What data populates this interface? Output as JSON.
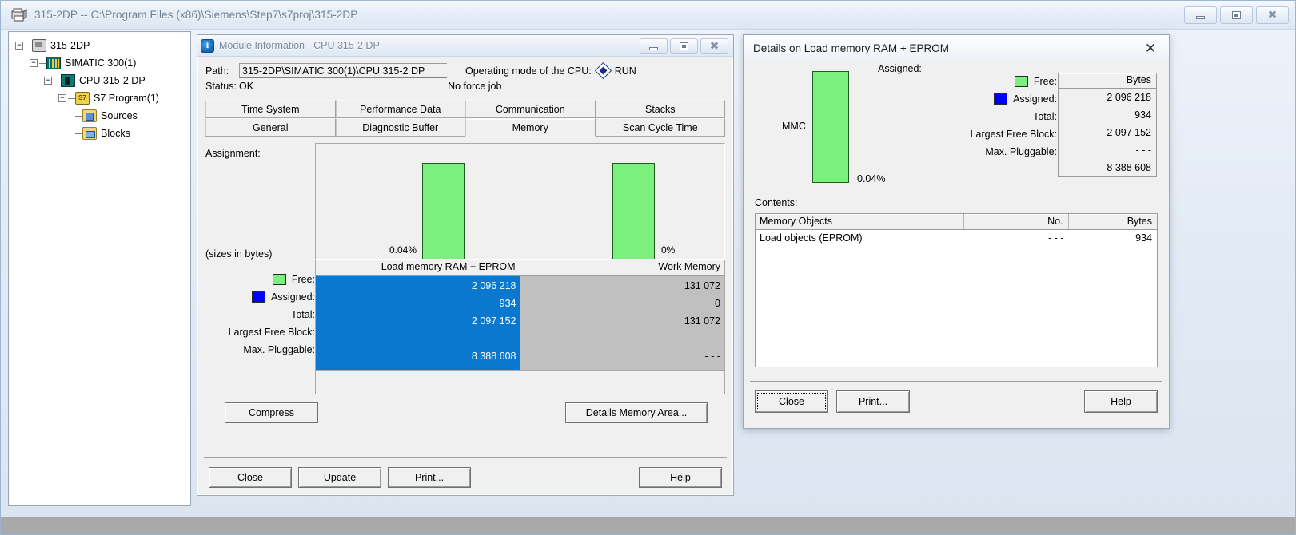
{
  "window": {
    "title": "315-2DP -- C:\\Program Files (x86)\\Siemens\\Step7\\s7proj\\315-2DP",
    "icon": "project-icon",
    "minimize": "–",
    "maximize": "□",
    "close": "✕"
  },
  "tree": {
    "items": [
      {
        "label": "315-2DP",
        "expander": "-",
        "icon": "project-icon",
        "indent": 0
      },
      {
        "label": "SIMATIC 300(1)",
        "expander": "-",
        "icon": "station-icon",
        "indent": 1
      },
      {
        "label": "CPU 315-2 DP",
        "expander": "-",
        "icon": "cpu-icon",
        "indent": 2
      },
      {
        "label": "S7 Program(1)",
        "expander": "-",
        "icon": "s7-program-icon",
        "indent": 3
      },
      {
        "label": "Sources",
        "expander": "",
        "icon": "sources-folder-icon",
        "indent": 4
      },
      {
        "label": "Blocks",
        "expander": "",
        "icon": "blocks-folder-icon",
        "indent": 4
      }
    ],
    "s7_icon_text": "S7"
  },
  "module_info": {
    "title": "Module Information - CPU 315-2 DP",
    "path_label": "Path:",
    "path_value": "315-2DP\\SIMATIC 300(1)\\CPU 315-2 DP",
    "status_label": "Status:",
    "status_value": "OK",
    "opmode_label": "Operating mode of the  CPU:",
    "opmode_value": "RUN",
    "force_job": "No force job",
    "tabs_top": [
      {
        "label": "Time System",
        "active": false
      },
      {
        "label": "Performance Data",
        "active": false
      },
      {
        "label": "Communication",
        "active": false
      },
      {
        "label": "Stacks",
        "active": false
      }
    ],
    "tabs_bottom": [
      {
        "label": "General",
        "active": false
      },
      {
        "label": "Diagnostic Buffer",
        "active": false
      },
      {
        "label": "Memory",
        "active": true
      },
      {
        "label": "Scan Cycle Time",
        "active": false
      }
    ],
    "assignment_label": "Assignment:",
    "sizes_label": "(sizes in bytes)",
    "legend": [
      {
        "label": "Free:",
        "color": "#7cf07c",
        "swatch": true
      },
      {
        "label": "Assigned:",
        "color": "#0000ff",
        "swatch": true
      },
      {
        "label": "Total:",
        "color": "",
        "swatch": false
      },
      {
        "label": "Largest Free Block:",
        "color": "",
        "swatch": false
      },
      {
        "label": "Max. Pluggable:",
        "color": "",
        "swatch": false
      }
    ],
    "columns": [
      {
        "header": "Load memory RAM + EPROM",
        "selected": true,
        "values": [
          "2 096 218",
          "934",
          "2 097 152",
          "- - -",
          "8 388 608"
        ]
      },
      {
        "header": "Work Memory",
        "selected": false,
        "values": [
          "131 072",
          "0",
          "131 072",
          "- - -",
          "- - -"
        ]
      }
    ],
    "buttons": {
      "compress": "Compress",
      "details_memory_area": "Details Memory Area...",
      "close": "Close",
      "update": "Update",
      "print": "Print...",
      "help": "Help"
    },
    "minimize": "–",
    "maximize": "□",
    "close_glyph": "✕"
  },
  "chart_data": {
    "type": "bar",
    "title": "Assignment",
    "charts": [
      {
        "name": "Load memory RAM + EPROM",
        "pct_label": "0.04%",
        "value": 0.04,
        "height_pct": 82,
        "color": "#7cf07c"
      },
      {
        "name": "Work Memory",
        "pct_label": "0%",
        "value": 0,
        "height_pct": 82,
        "color": "#7cf07c"
      }
    ],
    "ylim": [
      0,
      100
    ],
    "ylabel": "",
    "xlabel": "",
    "legend": [
      "Free",
      "Assigned"
    ],
    "series": [
      {
        "name": "Free",
        "color": "#7cf07c",
        "values": [
          2096218,
          131072
        ]
      },
      {
        "name": "Assigned",
        "color": "#0000ff",
        "values": [
          934,
          0
        ]
      }
    ],
    "categories": [
      "Load memory RAM + EPROM",
      "Work Memory"
    ]
  },
  "dialog": {
    "title": "Details on Load memory RAM + EPROM",
    "close_glyph": "✕",
    "mmc_label": "MMC",
    "mmc_pct": "0.04%",
    "assigned_caption": "Assigned:",
    "legend": [
      {
        "label": "Free:",
        "color": "#7cf07c",
        "swatch": true
      },
      {
        "label": "Assigned:",
        "color": "#0000ff",
        "swatch": true
      },
      {
        "label": "Total:",
        "color": "",
        "swatch": false
      },
      {
        "label": "Largest Free Block:",
        "color": "",
        "swatch": false
      },
      {
        "label": "Max. Pluggable:",
        "color": "",
        "swatch": false
      }
    ],
    "values_header": "Bytes",
    "values": [
      "2 096 218",
      "934",
      "2 097 152",
      "- - -",
      "8 388 608"
    ],
    "contents_label": "Contents:",
    "contents_headers": [
      "Memory Objects",
      "No.",
      "Bytes"
    ],
    "contents_rows": [
      {
        "object": "Load objects (EPROM)",
        "no": "- - -",
        "bytes": "934"
      }
    ],
    "buttons": {
      "close": "Close",
      "print": "Print...",
      "help": "Help"
    }
  },
  "chart_data_dialog": {
    "type": "bar",
    "title": "Details on Load memory RAM + EPROM",
    "categories": [
      "MMC"
    ],
    "values": [
      0.04
    ],
    "value_labels": [
      "0.04%"
    ],
    "ylim": [
      0,
      100
    ],
    "series": [
      {
        "name": "Free",
        "color": "#7cf07c",
        "values": [
          2096218
        ]
      },
      {
        "name": "Assigned",
        "color": "#0000ff",
        "values": [
          934
        ]
      }
    ]
  }
}
